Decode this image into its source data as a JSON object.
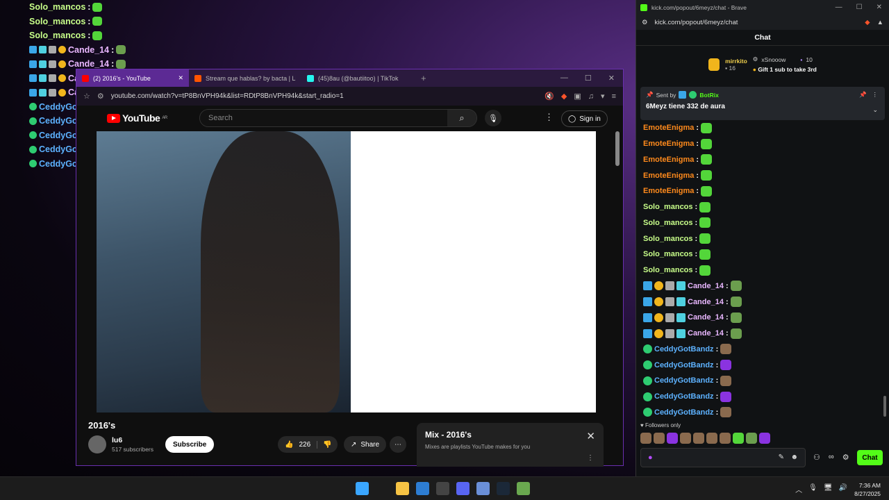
{
  "overlay_chat": [
    {
      "name": "Solo_mancos",
      "color": "green",
      "badges": [],
      "emote": "em-green"
    },
    {
      "name": "Solo_mancos",
      "color": "green",
      "badges": [],
      "emote": "em-green"
    },
    {
      "name": "Solo_mancos",
      "color": "green",
      "badges": [],
      "emote": "em-green"
    },
    {
      "name": "Cande_14",
      "color": "purple",
      "badges": [
        "b-blue",
        "b-cyan",
        "b-gray",
        "b-gold"
      ],
      "emote": "em-frog"
    },
    {
      "name": "Cande_14",
      "color": "purple",
      "badges": [
        "b-blue",
        "b-cyan",
        "b-gray",
        "b-gold"
      ],
      "emote": "em-frog"
    },
    {
      "name": "Cande_14",
      "color": "purple",
      "badges": [
        "b-blue",
        "b-cyan",
        "b-gray",
        "b-gold"
      ],
      "emote": "em-frog"
    },
    {
      "name": "Cande_14",
      "color": "purple",
      "badges": [
        "b-blue",
        "b-cyan",
        "b-gray",
        "b-gold"
      ],
      "emote": "em-frog"
    },
    {
      "name": "CeddyGotBandz",
      "color": "blue",
      "badges": [
        "b-check"
      ],
      "emote": "em-dog"
    },
    {
      "name": "CeddyGotBandz",
      "color": "blue",
      "badges": [
        "b-check"
      ],
      "emote": "em-dog"
    },
    {
      "name": "CeddyGotBandz",
      "color": "blue",
      "badges": [
        "b-check"
      ],
      "emote": "em-dog"
    },
    {
      "name": "CeddyGotBandz",
      "color": "blue",
      "badges": [
        "b-check"
      ],
      "emote": "em-purple"
    },
    {
      "name": "CeddyGotBandz",
      "color": "blue",
      "badges": [
        "b-check"
      ],
      "emote": "em-dog"
    }
  ],
  "youtube": {
    "tabs": [
      {
        "label": "(2) 2016's - YouTube",
        "icon_color": "#ff0000",
        "active": true
      },
      {
        "label": "Stream que hablas? by bacta | Listen",
        "icon_color": "#ff5500",
        "active": false
      },
      {
        "label": "(45)8au (@bautiitoo) | TikTok",
        "icon_color": "#25f4ee",
        "active": false
      }
    ],
    "url": "youtube.com/watch?v=tP8BnVPH94k&list=RDtP8BnVPH94k&start_radio=1",
    "url_display": "youtube.com/watch?v=tP8BnVPH94k&list=RDtP8BnVPH94k&start_radio=1",
    "logo_text": "YouTube",
    "logo_region": "AR",
    "search_placeholder": "Search",
    "sign_in": "Sign in",
    "video_title": "2016's",
    "channel_name": "lu6",
    "channel_subs": "517 subscribers",
    "subscribe": "Subscribe",
    "likes": "226",
    "share": "Share",
    "mix_title": "Mix - 2016's",
    "mix_sub": "Mixes are playlists YouTube makes for you"
  },
  "kick": {
    "window_title": "kick.com/popout/6meyz/chat - Brave",
    "url": "kick.com/popout/6meyz/chat",
    "header": "Chat",
    "gifter_name": "mirrkito",
    "gifter_count": "16",
    "gift_user": "xSnooow",
    "gift_count": "10",
    "gift_text": "Gift 1 sub to take 3rd",
    "pinned_sent_by": "Sent by",
    "pinned_bot": "BotRix",
    "pinned_msg": "6Meyz tiene 332 de aura",
    "followers_only": "Followers only",
    "chat_button": "Chat",
    "messages": [
      {
        "name": "EmoteEnigma",
        "color": "orange",
        "badges": [],
        "emote": "em-green"
      },
      {
        "name": "EmoteEnigma",
        "color": "orange",
        "badges": [],
        "emote": "em-green"
      },
      {
        "name": "EmoteEnigma",
        "color": "orange",
        "badges": [],
        "emote": "em-green"
      },
      {
        "name": "EmoteEnigma",
        "color": "orange",
        "badges": [],
        "emote": "em-green"
      },
      {
        "name": "EmoteEnigma",
        "color": "orange",
        "badges": [],
        "emote": "em-green"
      },
      {
        "name": "Solo_mancos",
        "color": "lime",
        "badges": [],
        "emote": "em-green"
      },
      {
        "name": "Solo_mancos",
        "color": "lime",
        "badges": [],
        "emote": "em-green"
      },
      {
        "name": "Solo_mancos",
        "color": "lime",
        "badges": [],
        "emote": "em-green"
      },
      {
        "name": "Solo_mancos",
        "color": "lime",
        "badges": [],
        "emote": "em-green"
      },
      {
        "name": "Solo_mancos",
        "color": "lime",
        "badges": [],
        "emote": "em-green"
      },
      {
        "name": "Cande_14",
        "color": "pink",
        "badges": [
          "b-blue",
          "b-gold",
          "b-gray",
          "b-cyan"
        ],
        "emote": "em-frog"
      },
      {
        "name": "Cande_14",
        "color": "pink",
        "badges": [
          "b-blue",
          "b-gold",
          "b-gray",
          "b-cyan"
        ],
        "emote": "em-frog"
      },
      {
        "name": "Cande_14",
        "color": "pink",
        "badges": [
          "b-blue",
          "b-gold",
          "b-gray",
          "b-cyan"
        ],
        "emote": "em-frog"
      },
      {
        "name": "Cande_14",
        "color": "pink",
        "badges": [
          "b-blue",
          "b-gold",
          "b-gray",
          "b-cyan"
        ],
        "emote": "em-frog"
      },
      {
        "name": "CeddyGotBandz",
        "color": "blue",
        "badges": [
          "b-check"
        ],
        "emote": "em-dog"
      },
      {
        "name": "CeddyGotBandz",
        "color": "blue",
        "badges": [
          "b-check"
        ],
        "emote": "em-purple"
      },
      {
        "name": "CeddyGotBandz",
        "color": "blue",
        "badges": [
          "b-check"
        ],
        "emote": "em-dog"
      },
      {
        "name": "CeddyGotBandz",
        "color": "blue",
        "badges": [
          "b-check"
        ],
        "emote": "em-purple"
      },
      {
        "name": "CeddyGotBandz",
        "color": "blue",
        "badges": [
          "b-check"
        ],
        "emote": "em-dog"
      }
    ]
  },
  "taskbar": {
    "time": "7:36 AM",
    "date": "8/27/2025",
    "app_icons": [
      {
        "name": "windows-start-icon",
        "color": "#3aa6ff"
      },
      {
        "name": "search-icon",
        "color": "#1c1c1c"
      },
      {
        "name": "file-explorer-icon",
        "color": "#f6c344"
      },
      {
        "name": "store-icon",
        "color": "#2d7dd2"
      },
      {
        "name": "chrome-icon",
        "color": "#444"
      },
      {
        "name": "discord-icon",
        "color": "#5865f2"
      },
      {
        "name": "brave-icon",
        "color": "#6a8fd8"
      },
      {
        "name": "steam-icon",
        "color": "#1b2838"
      },
      {
        "name": "minecraft-icon",
        "color": "#6aa84f"
      }
    ]
  },
  "colors": {
    "kick_green": "#53fc18",
    "youtube_red": "#ff0000",
    "window_border_purple": "#6a2fb0"
  }
}
